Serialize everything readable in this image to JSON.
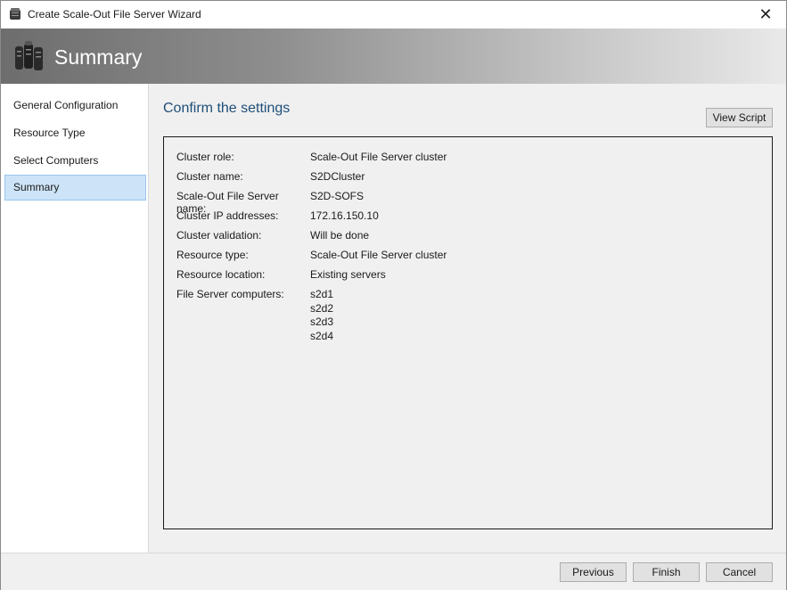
{
  "window": {
    "title": "Create Scale-Out File Server Wizard",
    "close_glyph": "✕"
  },
  "banner": {
    "title": "Summary",
    "icon": "server-rack-icon"
  },
  "nav": {
    "items": [
      {
        "label": "General Configuration",
        "active": false
      },
      {
        "label": "Resource Type",
        "active": false
      },
      {
        "label": "Select Computers",
        "active": false
      },
      {
        "label": "Summary",
        "active": true
      }
    ]
  },
  "main": {
    "section_title": "Confirm the settings",
    "view_script_label": "View Script",
    "settings": [
      {
        "label": "Cluster role:",
        "value": "Scale-Out File Server cluster"
      },
      {
        "label": "Cluster name:",
        "value": "S2DCluster"
      },
      {
        "label": "Scale-Out File Server name:",
        "value": "S2D-SOFS"
      },
      {
        "label": "Cluster IP addresses:",
        "value": "172.16.150.10"
      },
      {
        "label": "Cluster validation:",
        "value": "Will be done"
      },
      {
        "label": "Resource type:",
        "value": "Scale-Out File Server cluster"
      },
      {
        "label": "Resource location:",
        "value": "Existing servers"
      },
      {
        "label": "File Server computers:",
        "value": "s2d1\ns2d2\ns2d3\ns2d4"
      }
    ]
  },
  "footer": {
    "previous_label": "Previous",
    "finish_label": "Finish",
    "cancel_label": "Cancel"
  },
  "colors": {
    "accent_title": "#1e4e79",
    "nav_selected": "#cde3f7"
  }
}
